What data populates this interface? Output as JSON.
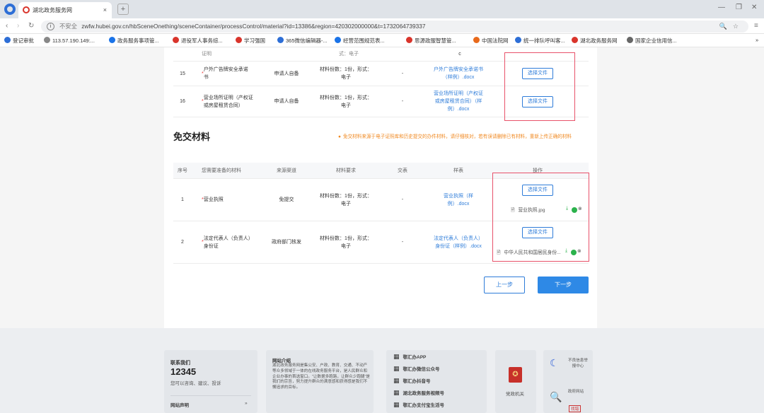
{
  "browser": {
    "tab_title": "湖北政务服务网",
    "new_tab": "+",
    "tab_close": "×",
    "not_secure": "不安全",
    "url": "zwfw.hubei.gov.cn/hbSceneOnething/sceneContainer/processControl/material?id=13386&region=420302000000&t=1732064739337",
    "bookmarks": [
      "登记审批",
      "113.57.190.149:...",
      "政务服务事项管...",
      "退役军人事务综...",
      "学习强国",
      "365微信编辑器-...",
      "经营范围规范表...",
      "思源政服智慧管...",
      "中国法院网",
      "统一排队呼叫客...",
      "湖北政务服务网",
      "国家企业信用信..."
    ]
  },
  "top_table": {
    "partial_text_1": "证明",
    "partial_text_2": "式：电子",
    "partial_text_3": "c",
    "rows": [
      {
        "no": "15",
        "name": "户外广告牌安全承诺书",
        "source": "申请人自备",
        "req": "材料份数：1份，形式：电子",
        "exempt": "-",
        "sample": "户外广告牌安全承诺书（样例）.docx",
        "action": "选择文件"
      },
      {
        "no": "16",
        "name": "营业场所证明（产权证或房屋租赁合同）",
        "source": "申请人自备",
        "req": "材料份数：1份，形式：电子",
        "exempt": "-",
        "sample": "营业场所证明（产权证或房屋租赁合同）（样例）.docx",
        "action": "选择文件"
      }
    ]
  },
  "exempt_section": {
    "title": "免交材料",
    "notice": "免交材料来源于电子证照库和历史提交的办件材料，请仔细核对，若有误请删除已有材料，重新上传正确的材料",
    "headers": [
      "序号",
      "您需要准备的材料",
      "来源渠道",
      "材料要求",
      "交表",
      "样表",
      "操作"
    ],
    "rows": [
      {
        "no": "1",
        "name": "营业执照",
        "source": "免提交",
        "req": "材料份数：1份，形式：电子",
        "exempt": "-",
        "sample": "营业执照（样例）.docx",
        "action": "选择文件",
        "file": "营业执照.jpg"
      },
      {
        "no": "2",
        "name": "法定代表人（负责人）身份证",
        "source": "政府部门核发",
        "req": "材料份数：1份，形式：电子",
        "exempt": "-",
        "sample": "法定代表人（负责人）身份证（样例）.docx",
        "action": "选择文件",
        "file": "中华人民共和国居民身份..."
      }
    ]
  },
  "buttons": {
    "prev": "上一步",
    "next": "下一步"
  },
  "footer": {
    "contact_title": "联系我们",
    "hotline": "12345",
    "contact_desc": "您可以咨询、建议、投诉",
    "statement": "网站声明",
    "statement_arrow": "»",
    "intro_title": "网站介绍",
    "intro_text": "湖北政务服务网是集公安、户政、教育、交通、不动产等众多领域于一体的在线政务服务平台，是人民群众和企业办事的首选窗口。“让数据多跑路，让群众少跑腿”是我们的宗旨，努力提升群众的满意感和获得感是我们不懈追求的目标。",
    "apps": [
      "鄂汇办APP",
      "鄂汇办微信公众号",
      "鄂汇办抖音号",
      "湖北政务服务视频号",
      "鄂汇办支付宝生活号"
    ],
    "party": "党政机关",
    "barrier_free": "不良信息举报中心",
    "error_site": "政府网站",
    "error_site_2": "找错"
  }
}
